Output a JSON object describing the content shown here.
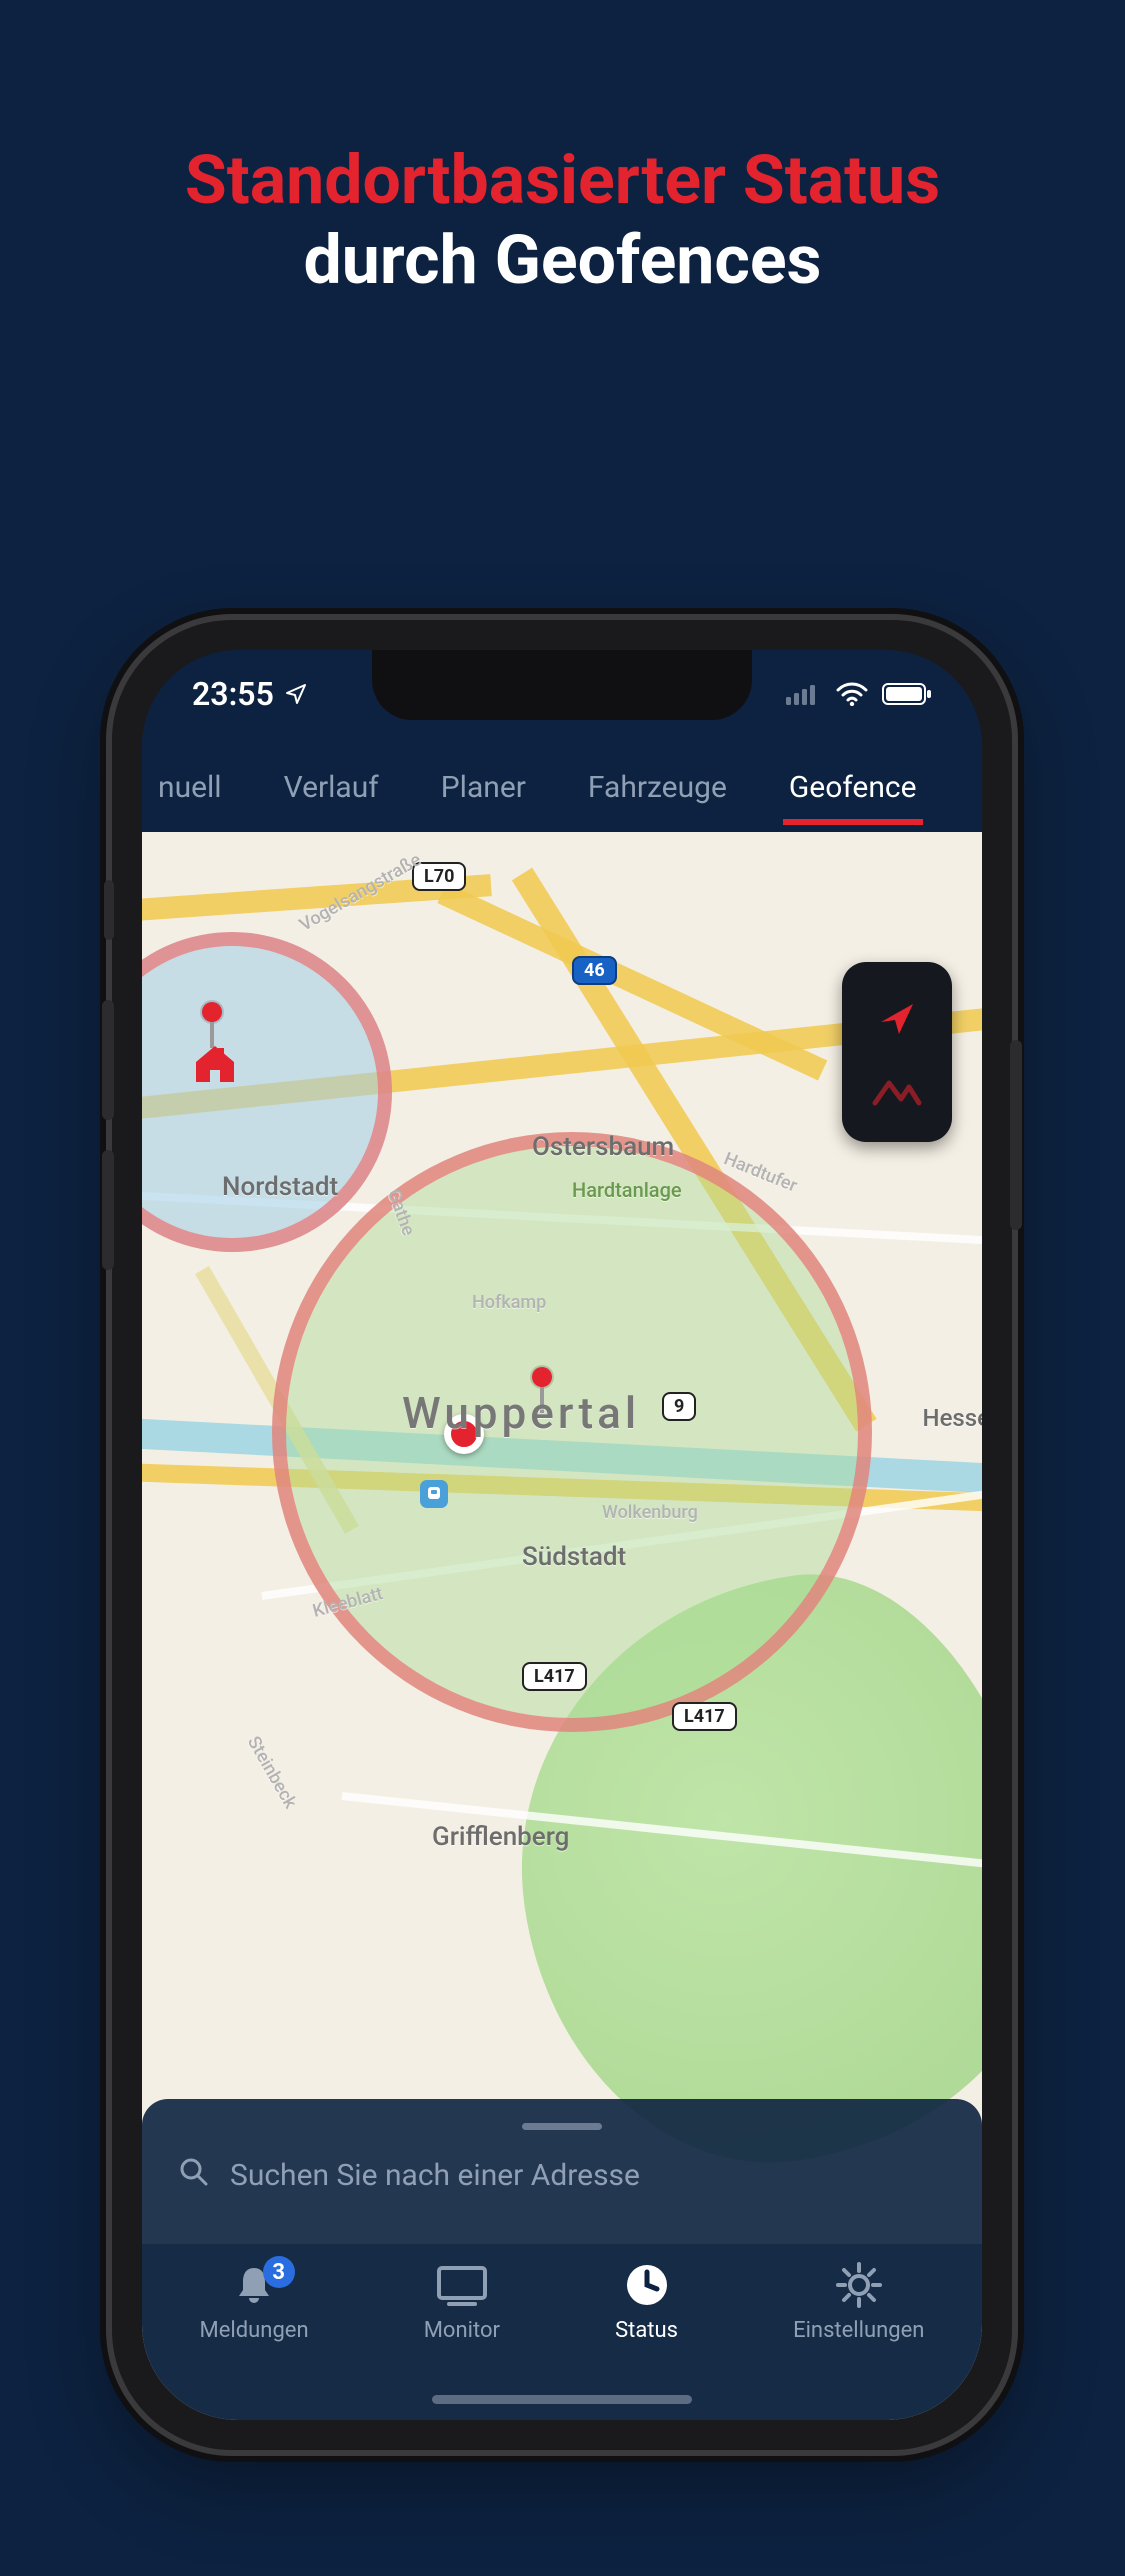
{
  "promo": {
    "line1": "Standortbasierter Status",
    "line2": "durch Geofences"
  },
  "status_bar": {
    "time": "23:55"
  },
  "top_tabs": [
    {
      "label": "nuell",
      "active": false
    },
    {
      "label": "Verlauf",
      "active": false
    },
    {
      "label": "Planer",
      "active": false
    },
    {
      "label": "Fahrzeuge",
      "active": false
    },
    {
      "label": "Geofence",
      "active": true
    }
  ],
  "map": {
    "city_main": "Wuppertal",
    "districts": {
      "nordstadt": "Nordstadt",
      "ostersbaum": "Ostersbaum",
      "hardtanlage": "Hardtanlage",
      "suedstadt": "Südstadt",
      "grifflenberg": "Grifflenberg",
      "hesse": "Hesse"
    },
    "streets": {
      "vogelsangstrasse": "Vogelsangstraße",
      "gathe": "Gathe",
      "hofkamp": "Hofkamp",
      "wolkenburg": "Wolkenburg",
      "kleeblatt": "Kleeblatt",
      "steinbeck": "Steinbeck",
      "hardtufer": "Hardtufer"
    },
    "road_shields": {
      "l70": "L70",
      "a46": "46",
      "b9": "9",
      "l417a": "L417",
      "l417b": "L417"
    }
  },
  "search": {
    "placeholder": "Suchen Sie nach einer Adresse"
  },
  "bottom_tabs": {
    "items": [
      {
        "label": "Meldungen",
        "badge": "3"
      },
      {
        "label": "Monitor"
      },
      {
        "label": "Status"
      },
      {
        "label": "Einstellungen"
      }
    ],
    "active_index": 2
  }
}
